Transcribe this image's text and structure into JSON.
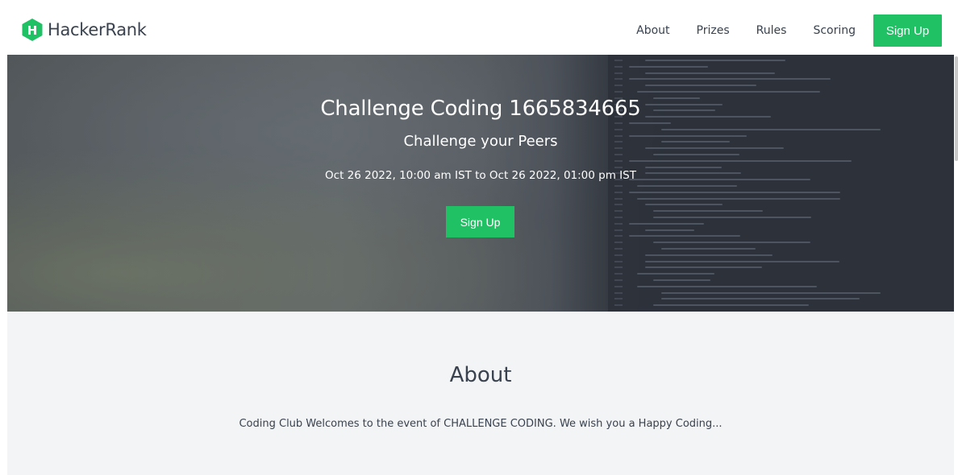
{
  "brand": {
    "logo_letter": "H",
    "name": "HackerRank",
    "color": "#1fc164"
  },
  "nav": {
    "items": [
      {
        "label": "About"
      },
      {
        "label": "Prizes"
      },
      {
        "label": "Rules"
      },
      {
        "label": "Scoring"
      }
    ],
    "signup_label": "Sign Up"
  },
  "hero": {
    "title": "Challenge Coding 1665834665",
    "subtitle": "Challenge your Peers",
    "date_range": "Oct 26 2022, 10:00 am IST to Oct 26 2022, 01:00 pm IST",
    "signup_label": "Sign Up"
  },
  "about": {
    "title": "About",
    "description": "Coding Club Welcomes to the event of CHALLENGE CODING. We wish you a Happy Coding..."
  },
  "colors": {
    "accent": "#1fc164",
    "text": "#39424e",
    "about_bg": "#f3f4f6"
  }
}
